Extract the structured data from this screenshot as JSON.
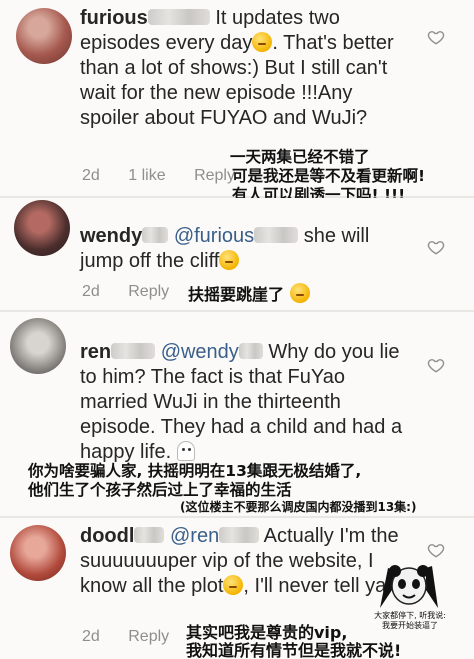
{
  "comments": [
    {
      "username": "furious",
      "text_parts": [
        "It updates two episodes every day",
        ". That's better than a lot of shows:) But I still can't wait for the new episode !!!Any spoiler about FUYAO and WuJi?"
      ],
      "time": "2d",
      "likes": "1 like",
      "reply": "Reply",
      "overlay_cn": [
        "一天两集已经不错了",
        "可是我还是等不及看更新啊!",
        "有人可以剧透一下吗! !!!"
      ]
    },
    {
      "username": "wendy",
      "mention": "@furious",
      "text_parts": [
        "she will jump off the cliff"
      ],
      "time": "2d",
      "reply": "Reply",
      "overlay_cn": [
        "扶摇要跳崖了"
      ]
    },
    {
      "username": "ren",
      "mention": "@wendy",
      "text_parts": [
        "Why do you lie to him? The fact is that FuYao married WuJi in the thirteenth episode. They had a child and had a happy life."
      ],
      "overlay_cn": [
        "你为啥要骗人家, 扶摇明明在13集跟无极结婚了,",
        "他们生了个孩子然后过上了幸福的生活",
        "(这位楼主不要那么调皮国内都没播到13集:)"
      ]
    },
    {
      "username": "doodl",
      "mention": "@ren",
      "text_parts": [
        "Actually I'm the suuuuuuuper vip of the website, I know all the plot",
        ", I'll never tell yall"
      ],
      "time": "2d",
      "reply": "Reply",
      "overlay_cn": [
        "其实吧我是尊贵的vip,",
        "我知道所有情节但是我就不说!"
      ],
      "sticker_caption": [
        "大家都停下, 听我说:",
        "我要开始装逼了"
      ]
    }
  ],
  "icons": {
    "heart": "heart-outline-icon",
    "emoji_thinking": "thinking-face-emoji",
    "emoji_smile": "smiling-face-emoji",
    "ghost": "ghost-emoji",
    "panda": "panda-meme-sticker"
  },
  "colors": {
    "background": "#fbfaf8",
    "separator": "#e9e7e3",
    "meta_text": "#8e8e8e",
    "body_text": "#262626"
  }
}
